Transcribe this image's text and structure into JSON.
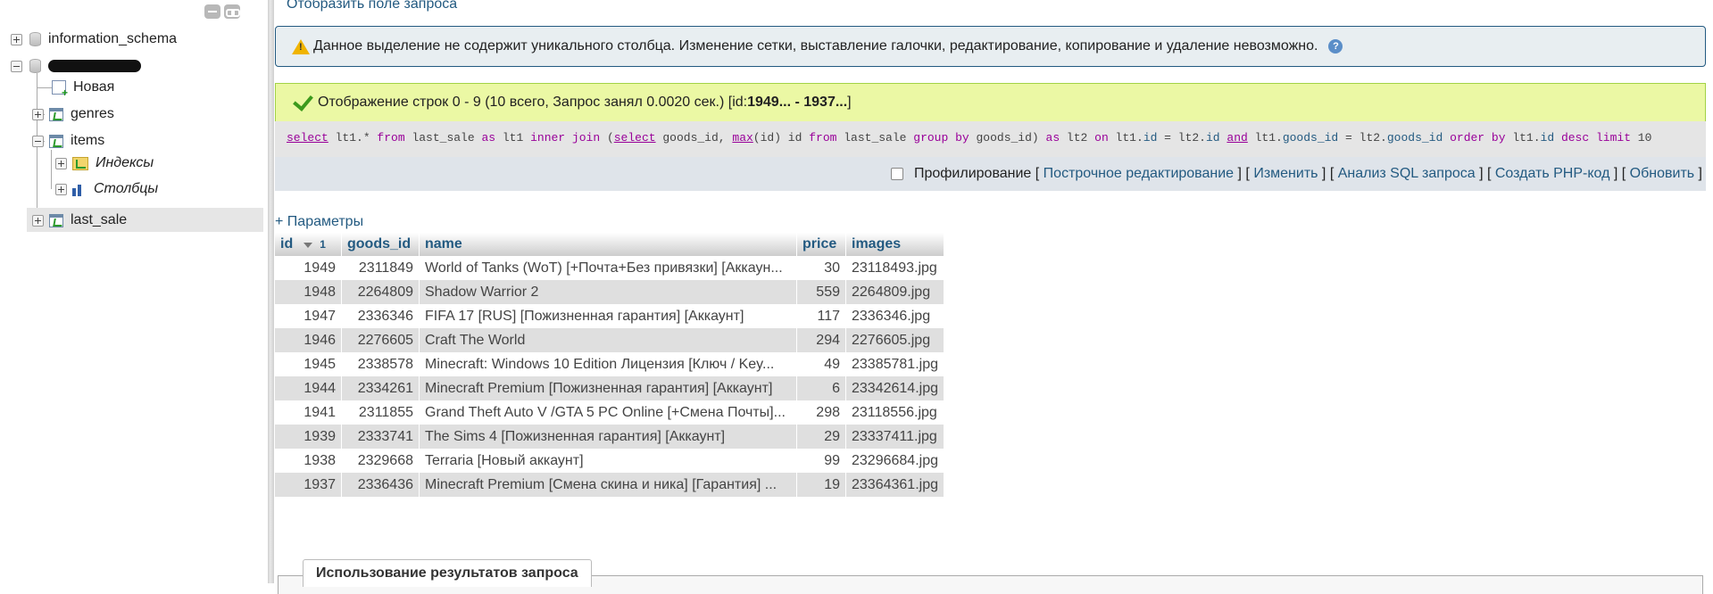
{
  "sidebar": {
    "databases": [
      {
        "label": "information_schema"
      },
      {
        "label": ""
      }
    ],
    "tree": {
      "new_label": "Новая",
      "tables": [
        {
          "label": "genres"
        },
        {
          "label": "items",
          "children": [
            {
              "label": "Индексы"
            },
            {
              "label": "Столбцы"
            }
          ]
        },
        {
          "label": "last_sale"
        }
      ]
    }
  },
  "main": {
    "show_query_link": "Отобразить поле запроса",
    "warning_text": "Данное выделение не содержит уникального столбца. Изменение сетки, выставление галочки, редактирование, копирование и удаление невозможно.",
    "success_prefix": "Отображение строк 0 - 9 (10 всего, Запрос занял 0.0020 сек.) [id: ",
    "success_range": "1949... - 1937...",
    "success_suffix": "]",
    "sql": {
      "t1": "select",
      "t2": " lt1.* ",
      "t3": "from",
      "t4": " last_sale ",
      "t5": "as",
      "t6": " lt1 ",
      "t7": "inner",
      "t8": " ",
      "t9": "join",
      "t10": " (",
      "t11": "select",
      "t12": " goods_id, ",
      "t13": "max",
      "t14": "(id) id ",
      "t15": "from",
      "t16": " last_sale ",
      "t17": "group by",
      "t18": " goods_id) ",
      "t19": "as",
      "t20": " lt2 ",
      "t21": "on",
      "t22": " lt1.",
      "t23": "id",
      "t24": " = lt2.",
      "t25": "id",
      "t26": " ",
      "t27": "and",
      "t28": " lt1.",
      "t29": "goods_id",
      "t30": " = lt2.",
      "t31": "goods_id",
      "t32": " ",
      "t33": "order by",
      "t34": " lt1.",
      "t35": "id",
      "t36": " ",
      "t37": "desc",
      "t38": " ",
      "t39": "limit",
      "t40": " 10"
    },
    "tools": {
      "profiling": "Профилирование",
      "inline_edit": "Построчное редактирование",
      "edit": "Изменить",
      "analyze": "Анализ SQL запроса",
      "create_php": "Создать PHP-код",
      "refresh": "Обновить"
    },
    "params_link": "+ Параметры",
    "table": {
      "headers": {
        "id": "id",
        "sort_num": "1",
        "goods_id": "goods_id",
        "name": "name",
        "price": "price",
        "images": "images"
      },
      "rows": [
        {
          "id": "1949",
          "goods_id": "2311849",
          "name": "World of Tanks (WoT) [+Почта+Без привязки] [Аккаун...",
          "price": "30",
          "images": "23118493.jpg"
        },
        {
          "id": "1948",
          "goods_id": "2264809",
          "name": "Shadow Warrior 2",
          "price": "559",
          "images": "2264809.jpg"
        },
        {
          "id": "1947",
          "goods_id": "2336346",
          "name": "FIFA 17 [RUS] [Пожизненная гарантия] [Аккаунт]",
          "price": "117",
          "images": "2336346.jpg"
        },
        {
          "id": "1946",
          "goods_id": "2276605",
          "name": "Craft The World",
          "price": "294",
          "images": "2276605.jpg"
        },
        {
          "id": "1945",
          "goods_id": "2338578",
          "name": "Minecraft: Windows 10 Edition Лицензия [Ключ / Key...",
          "price": "49",
          "images": "23385781.jpg"
        },
        {
          "id": "1944",
          "goods_id": "2334261",
          "name": "Minecraft Premium [Пожизненная гарантия] [Аккаунт]",
          "price": "6",
          "images": "23342614.jpg"
        },
        {
          "id": "1941",
          "goods_id": "2311855",
          "name": "Grand Theft Auto V /GTA 5 PC Online [+Смена Почты]...",
          "price": "298",
          "images": "23118556.jpg"
        },
        {
          "id": "1939",
          "goods_id": "2333741",
          "name": "The Sims 4 [Пожизненная гарантия] [Аккаунт]",
          "price": "29",
          "images": "23337411.jpg"
        },
        {
          "id": "1938",
          "goods_id": "2329668",
          "name": "Terraria [Новый аккаунт]",
          "price": "99",
          "images": "23296684.jpg"
        },
        {
          "id": "1937",
          "goods_id": "2336436",
          "name": "Minecraft Premium [Смена скина и ника] [Гарантия] ...",
          "price": "19",
          "images": "23364361.jpg"
        }
      ]
    },
    "bottom_tab": "Использование результатов запроса"
  }
}
